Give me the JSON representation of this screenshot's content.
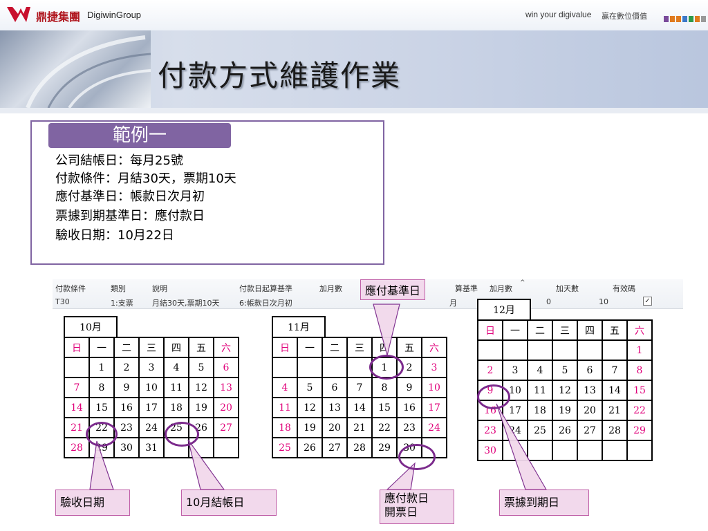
{
  "header": {
    "logo_cn": "鼎捷集團",
    "logo_en": "DigiwinGroup",
    "slogan_en": "win your digivalue",
    "slogan_cn": "贏在數位價值",
    "block_colors": [
      "#7a4a9b",
      "#e07b1f",
      "#e07b1f",
      "#3c78c8",
      "#2e9a4a",
      "#e07b1f",
      "#999999"
    ]
  },
  "title": "付款方式維護作業",
  "example": {
    "label": "範例一",
    "lines": [
      "公司結帳日：每月25號",
      "付款條件：月結30天，票期10天",
      "應付基準日：帳款日次月初",
      "票據到期基準日：應付款日",
      "驗收日期：10月22日"
    ]
  },
  "grid": {
    "headers": [
      "付款條件",
      "類別",
      "說明",
      "付款日起算基準",
      "加月數",
      "算基準",
      "加月數",
      "加天數",
      "有效碼"
    ],
    "row": [
      "T30",
      "1:支票",
      "月結30天,票期10天",
      "6:帳款日次月初",
      "",
      "月",
      "0",
      "10",
      "✓"
    ]
  },
  "calendars": {
    "weekdays": [
      "日",
      "一",
      "二",
      "三",
      "四",
      "五",
      "六"
    ],
    "oct": {
      "title": "10月",
      "rows": [
        [
          "",
          "1",
          "2",
          "3",
          "4",
          "5",
          "6"
        ],
        [
          "7",
          "8",
          "9",
          "10",
          "11",
          "12",
          "13"
        ],
        [
          "14",
          "15",
          "16",
          "17",
          "18",
          "19",
          "20"
        ],
        [
          "21",
          "22",
          "23",
          "24",
          "25",
          "26",
          "27"
        ],
        [
          "28",
          "29",
          "30",
          "31",
          "",
          "",
          ""
        ]
      ]
    },
    "nov": {
      "title": "11月",
      "rows": [
        [
          "",
          "",
          "",
          "",
          "1",
          "2",
          "3"
        ],
        [
          "4",
          "5",
          "6",
          "7",
          "8",
          "9",
          "10"
        ],
        [
          "11",
          "12",
          "13",
          "14",
          "15",
          "16",
          "17"
        ],
        [
          "18",
          "19",
          "20",
          "21",
          "22",
          "23",
          "24"
        ],
        [
          "25",
          "26",
          "27",
          "28",
          "29",
          "30",
          ""
        ]
      ]
    },
    "dec": {
      "title": "12月",
      "rows": [
        [
          "",
          "",
          "",
          "",
          "",
          "",
          "1"
        ],
        [
          "2",
          "3",
          "4",
          "5",
          "6",
          "7",
          "8"
        ],
        [
          "9",
          "10",
          "11",
          "12",
          "13",
          "14",
          "15"
        ],
        [
          "16",
          "17",
          "18",
          "19",
          "20",
          "21",
          "22"
        ],
        [
          "23",
          "24",
          "25",
          "26",
          "27",
          "28",
          "29"
        ],
        [
          "30",
          "",
          "",
          "",
          "",
          "",
          ""
        ]
      ]
    }
  },
  "callouts": {
    "payable_base": "應付基準日",
    "acceptance": "驗收日期",
    "closing": "10月結帳日",
    "payment_date_1": "應付款日",
    "payment_date_2": "開票日",
    "due_date": "票據到期日"
  }
}
